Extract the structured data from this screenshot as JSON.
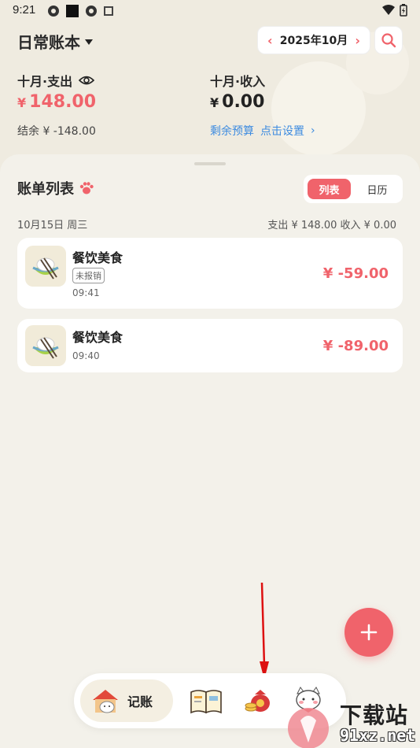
{
  "status_bar": {
    "time": "9:21"
  },
  "header": {
    "book_name": "日常账本",
    "month": "2025年10月"
  },
  "summary": {
    "expense_title": "十月·支出",
    "expense_currency": "¥",
    "expense_amount": "148.00",
    "balance_text": "结余 ¥ -148.00",
    "income_title": "十月·收入",
    "income_currency": "¥",
    "income_amount": "0.00",
    "budget_label": "剩余预算",
    "budget_action": "点击设置"
  },
  "bill_list": {
    "title": "账单列表",
    "toggle": [
      "列表",
      "日历"
    ],
    "date_label": "10月15日 周三",
    "date_totals": "支出 ¥ 148.00   收入 ¥ 0.00",
    "entries": [
      {
        "category": "餐饮美食",
        "tag": "未报销",
        "time": "09:41",
        "amount": "¥ -59.00"
      },
      {
        "category": "餐饮美食",
        "time": "09:40",
        "amount": "¥ -89.00"
      }
    ]
  },
  "bottom_nav": {
    "active_label": "记账",
    "icons": [
      "cat-house-icon",
      "book-icon",
      "money-bag-icon",
      "cat-avatar-icon"
    ]
  },
  "watermark": {
    "line1": "下载站",
    "line2": "91xz.net"
  },
  "colors": {
    "accent": "#f0636b",
    "link": "#3d8be0",
    "background": "#f2efe6"
  }
}
